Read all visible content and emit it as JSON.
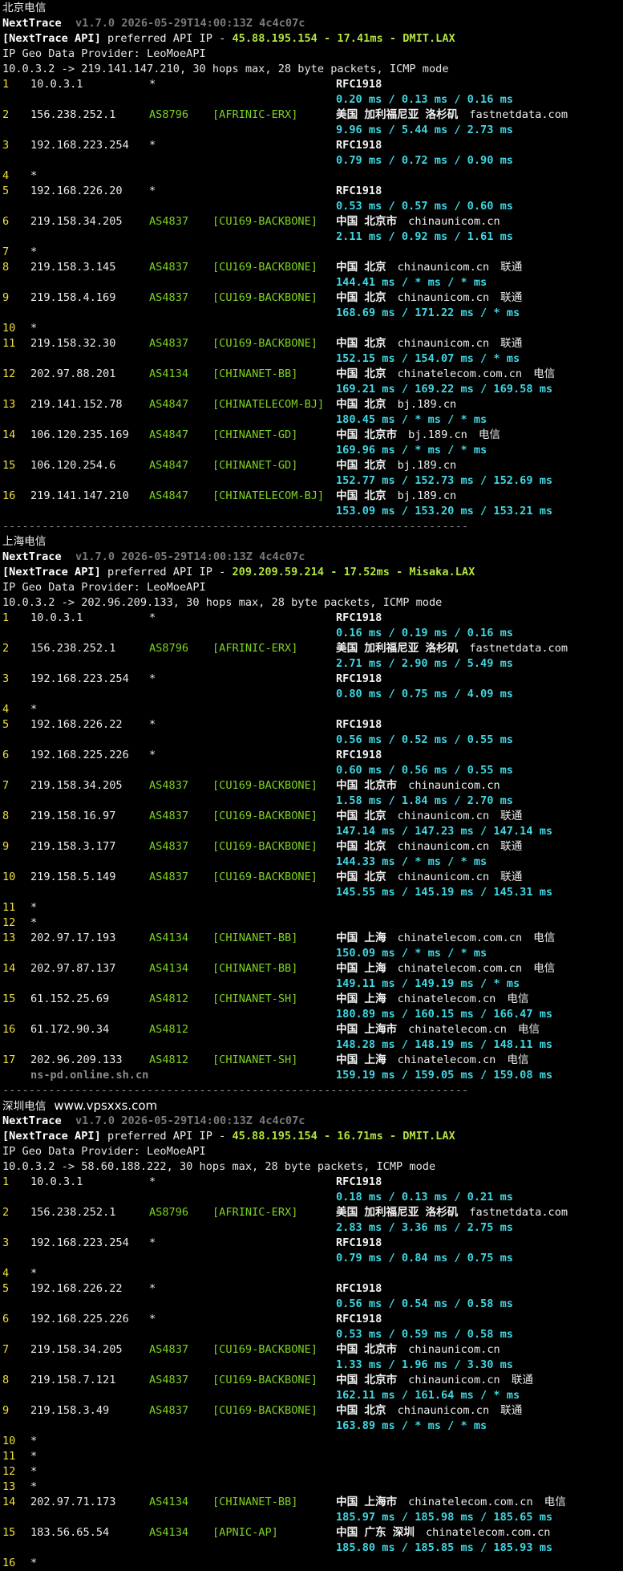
{
  "colors": {
    "background": "#000000",
    "hop": "#f1df3a",
    "asn": "#7ed321",
    "latency": "#3fd7e3",
    "highlight": "#b2e33d"
  },
  "separator": "-----------------------------------------------------------------------",
  "sections": [
    {
      "title": "北京电信",
      "site": "",
      "tool": "NextTrace",
      "version": "v1.7.0 2026-05-29T14:00:13Z 4c4c07c",
      "api_prefix": "[NextTrace API]",
      "api_text": " preferred API IP - ",
      "api_highlight": "45.88.195.154 - 17.41ms - DMIT.LAX",
      "provider": "IP Geo Data Provider: LeoMoeAPI",
      "route": "10.0.3.2 -> 219.141.147.210, 30 hops max, 28 byte packets, ICMP mode",
      "hops": [
        {
          "n": "1",
          "ip": "10.0.3.1",
          "as": "*",
          "tag": "",
          "geo": "RFC1918",
          "dom": "",
          "isp": "",
          "lat": "0.20 ms / 0.13 ms / 0.16 ms"
        },
        {
          "n": "2",
          "ip": "156.238.252.1",
          "as": "AS8796",
          "tag": "[AFRINIC-ERX]",
          "geo": "美国 加利福尼亚 洛杉矶",
          "dom": "fastnetdata.com",
          "isp": "",
          "lat": "9.96 ms / 5.44 ms / 2.73 ms"
        },
        {
          "n": "3",
          "ip": "192.168.223.254",
          "as": "*",
          "tag": "",
          "geo": "RFC1918",
          "dom": "",
          "isp": "",
          "lat": "0.79 ms / 0.72 ms / 0.90 ms"
        },
        {
          "n": "4",
          "ip": "*",
          "as": "",
          "tag": "",
          "geo": "",
          "dom": "",
          "isp": "",
          "lat": ""
        },
        {
          "n": "5",
          "ip": "192.168.226.20",
          "as": "*",
          "tag": "",
          "geo": "RFC1918",
          "dom": "",
          "isp": "",
          "lat": "0.53 ms / 0.57 ms / 0.60 ms"
        },
        {
          "n": "6",
          "ip": "219.158.34.205",
          "as": "AS4837",
          "tag": "[CU169-BACKBONE]",
          "geo": "中国 北京市",
          "dom": "chinaunicom.cn",
          "isp": "",
          "lat": "2.11 ms / 0.92 ms / 1.61 ms"
        },
        {
          "n": "7",
          "ip": "*",
          "as": "",
          "tag": "",
          "geo": "",
          "dom": "",
          "isp": "",
          "lat": ""
        },
        {
          "n": "8",
          "ip": "219.158.3.145",
          "as": "AS4837",
          "tag": "[CU169-BACKBONE]",
          "geo": "中国 北京",
          "dom": "chinaunicom.cn",
          "isp": "联通",
          "lat": "144.41 ms / * ms / * ms"
        },
        {
          "n": "9",
          "ip": "219.158.4.169",
          "as": "AS4837",
          "tag": "[CU169-BACKBONE]",
          "geo": "中国 北京",
          "dom": "chinaunicom.cn",
          "isp": "联通",
          "lat": "168.69 ms / 171.22 ms / * ms"
        },
        {
          "n": "10",
          "ip": "*",
          "as": "",
          "tag": "",
          "geo": "",
          "dom": "",
          "isp": "",
          "lat": ""
        },
        {
          "n": "11",
          "ip": "219.158.32.30",
          "as": "AS4837",
          "tag": "[CU169-BACKBONE]",
          "geo": "中国 北京",
          "dom": "chinaunicom.cn",
          "isp": "联通",
          "lat": "152.15 ms / 154.07 ms / * ms"
        },
        {
          "n": "12",
          "ip": "202.97.88.201",
          "as": "AS4134",
          "tag": "[CHINANET-BB]",
          "geo": "中国 北京",
          "dom": "chinatelecom.com.cn",
          "isp": "电信",
          "lat": "169.21 ms / 169.22 ms / 169.58 ms"
        },
        {
          "n": "13",
          "ip": "219.141.152.78",
          "as": "AS4847",
          "tag": "[CHINATELECOM-BJ]",
          "geo": "中国 北京",
          "dom": "bj.189.cn",
          "isp": "",
          "lat": "180.45 ms / * ms / * ms"
        },
        {
          "n": "14",
          "ip": "106.120.235.169",
          "as": "AS4847",
          "tag": "[CHINANET-GD]",
          "geo": "中国 北京市",
          "dom": "bj.189.cn",
          "isp": "电信",
          "lat": "169.96 ms / * ms / * ms"
        },
        {
          "n": "15",
          "ip": "106.120.254.6",
          "as": "AS4847",
          "tag": "[CHINANET-GD]",
          "geo": "中国 北京",
          "dom": "bj.189.cn",
          "isp": "",
          "lat": "152.77 ms / 152.73 ms / 152.69 ms"
        },
        {
          "n": "16",
          "ip": "219.141.147.210",
          "as": "AS4847",
          "tag": "[CHINATELECOM-BJ]",
          "geo": "中国 北京",
          "dom": "bj.189.cn",
          "isp": "",
          "lat": "153.09 ms / 153.20 ms / 153.21 ms"
        }
      ]
    },
    {
      "title": "上海电信",
      "site": "",
      "tool": "NextTrace",
      "version": "v1.7.0 2026-05-29T14:00:13Z 4c4c07c",
      "api_prefix": "[NextTrace API]",
      "api_text": " preferred API IP - ",
      "api_highlight": "209.209.59.214 - 17.52ms - Misaka.LAX",
      "provider": "IP Geo Data Provider: LeoMoeAPI",
      "route": "10.0.3.2 -> 202.96.209.133, 30 hops max, 28 byte packets, ICMP mode",
      "hops": [
        {
          "n": "1",
          "ip": "10.0.3.1",
          "as": "*",
          "tag": "",
          "geo": "RFC1918",
          "dom": "",
          "isp": "",
          "lat": "0.16 ms / 0.19 ms / 0.16 ms"
        },
        {
          "n": "2",
          "ip": "156.238.252.1",
          "as": "AS8796",
          "tag": "[AFRINIC-ERX]",
          "geo": "美国 加利福尼亚 洛杉矶",
          "dom": "fastnetdata.com",
          "isp": "",
          "lat": "2.71 ms / 2.90 ms / 5.49 ms"
        },
        {
          "n": "3",
          "ip": "192.168.223.254",
          "as": "*",
          "tag": "",
          "geo": "RFC1918",
          "dom": "",
          "isp": "",
          "lat": "0.80 ms / 0.75 ms / 4.09 ms"
        },
        {
          "n": "4",
          "ip": "*",
          "as": "",
          "tag": "",
          "geo": "",
          "dom": "",
          "isp": "",
          "lat": ""
        },
        {
          "n": "5",
          "ip": "192.168.226.22",
          "as": "*",
          "tag": "",
          "geo": "RFC1918",
          "dom": "",
          "isp": "",
          "lat": "0.56 ms / 0.52 ms / 0.55 ms"
        },
        {
          "n": "6",
          "ip": "192.168.225.226",
          "as": "*",
          "tag": "",
          "geo": "RFC1918",
          "dom": "",
          "isp": "",
          "lat": "0.60 ms / 0.56 ms / 0.55 ms"
        },
        {
          "n": "7",
          "ip": "219.158.34.205",
          "as": "AS4837",
          "tag": "[CU169-BACKBONE]",
          "geo": "中国 北京市",
          "dom": "chinaunicom.cn",
          "isp": "",
          "lat": "1.58 ms / 1.84 ms / 2.70 ms"
        },
        {
          "n": "8",
          "ip": "219.158.16.97",
          "as": "AS4837",
          "tag": "[CU169-BACKBONE]",
          "geo": "中国 北京",
          "dom": "chinaunicom.cn",
          "isp": "联通",
          "lat": "147.14 ms / 147.23 ms / 147.14 ms"
        },
        {
          "n": "9",
          "ip": "219.158.3.177",
          "as": "AS4837",
          "tag": "[CU169-BACKBONE]",
          "geo": "中国 北京",
          "dom": "chinaunicom.cn",
          "isp": "联通",
          "lat": "144.33 ms / * ms / * ms"
        },
        {
          "n": "10",
          "ip": "219.158.5.149",
          "as": "AS4837",
          "tag": "[CU169-BACKBONE]",
          "geo": "中国 北京",
          "dom": "chinaunicom.cn",
          "isp": "联通",
          "lat": "145.55 ms / 145.19 ms / 145.31 ms"
        },
        {
          "n": "11",
          "ip": "*",
          "as": "",
          "tag": "",
          "geo": "",
          "dom": "",
          "isp": "",
          "lat": ""
        },
        {
          "n": "12",
          "ip": "*",
          "as": "",
          "tag": "",
          "geo": "",
          "dom": "",
          "isp": "",
          "lat": ""
        },
        {
          "n": "13",
          "ip": "202.97.17.193",
          "as": "AS4134",
          "tag": "[CHINANET-BB]",
          "geo": "中国 上海",
          "dom": "chinatelecom.com.cn",
          "isp": "电信",
          "lat": "150.09 ms / * ms / * ms"
        },
        {
          "n": "14",
          "ip": "202.97.87.137",
          "as": "AS4134",
          "tag": "[CHINANET-BB]",
          "geo": "中国 上海",
          "dom": "chinatelecom.com.cn",
          "isp": "电信",
          "lat": "149.11 ms / 149.19 ms / * ms"
        },
        {
          "n": "15",
          "ip": "61.152.25.69",
          "as": "AS4812",
          "tag": "[CHINANET-SH]",
          "geo": "中国 上海",
          "dom": "chinatelecom.cn",
          "isp": "电信",
          "lat": "180.89 ms / 160.15 ms / 166.47 ms"
        },
        {
          "n": "16",
          "ip": "61.172.90.34",
          "as": "AS4812",
          "tag": "",
          "geo": "中国 上海市",
          "dom": "chinatelecom.cn",
          "isp": "电信",
          "lat": "148.28 ms / 148.19 ms / 148.11 ms"
        },
        {
          "n": "17",
          "ip": "202.96.209.133",
          "as": "AS4812",
          "tag": "[CHINANET-SH]",
          "geo": "中国 上海",
          "dom": "chinatelecom.cn",
          "isp": "电信",
          "ptr": "ns-pd.online.sh.cn",
          "lat": "159.19 ms / 159.05 ms / 159.08 ms"
        }
      ]
    },
    {
      "title": "深圳电信",
      "site": "www.vpsxxs.com",
      "tool": "NextTrace",
      "version": "v1.7.0 2026-05-29T14:00:13Z 4c4c07c",
      "api_prefix": "[NextTrace API]",
      "api_text": " preferred API IP - ",
      "api_highlight": "45.88.195.154 - 16.71ms - DMIT.LAX",
      "provider": "IP Geo Data Provider: LeoMoeAPI",
      "route": "10.0.3.2 -> 58.60.188.222, 30 hops max, 28 byte packets, ICMP mode",
      "hops": [
        {
          "n": "1",
          "ip": "10.0.3.1",
          "as": "*",
          "tag": "",
          "geo": "RFC1918",
          "dom": "",
          "isp": "",
          "lat": "0.18 ms / 0.13 ms / 0.21 ms"
        },
        {
          "n": "2",
          "ip": "156.238.252.1",
          "as": "AS8796",
          "tag": "[AFRINIC-ERX]",
          "geo": "美国 加利福尼亚 洛杉矶",
          "dom": "fastnetdata.com",
          "isp": "",
          "lat": "2.83 ms / 3.36 ms / 2.75 ms"
        },
        {
          "n": "3",
          "ip": "192.168.223.254",
          "as": "*",
          "tag": "",
          "geo": "RFC1918",
          "dom": "",
          "isp": "",
          "lat": "0.79 ms / 0.84 ms / 0.75 ms"
        },
        {
          "n": "4",
          "ip": "*",
          "as": "",
          "tag": "",
          "geo": "",
          "dom": "",
          "isp": "",
          "lat": ""
        },
        {
          "n": "5",
          "ip": "192.168.226.22",
          "as": "*",
          "tag": "",
          "geo": "RFC1918",
          "dom": "",
          "isp": "",
          "lat": "0.56 ms / 0.54 ms / 0.58 ms"
        },
        {
          "n": "6",
          "ip": "192.168.225.226",
          "as": "*",
          "tag": "",
          "geo": "RFC1918",
          "dom": "",
          "isp": "",
          "lat": "0.53 ms / 0.59 ms / 0.58 ms"
        },
        {
          "n": "7",
          "ip": "219.158.34.205",
          "as": "AS4837",
          "tag": "[CU169-BACKBONE]",
          "geo": "中国 北京市",
          "dom": "chinaunicom.cn",
          "isp": "",
          "lat": "1.33 ms / 1.96 ms / 3.30 ms"
        },
        {
          "n": "8",
          "ip": "219.158.7.121",
          "as": "AS4837",
          "tag": "[CU169-BACKBONE]",
          "geo": "中国 北京市",
          "dom": "chinaunicom.cn",
          "isp": "联通",
          "lat": "162.11 ms / 161.64 ms / * ms"
        },
        {
          "n": "9",
          "ip": "219.158.3.49",
          "as": "AS4837",
          "tag": "[CU169-BACKBONE]",
          "geo": "中国 北京",
          "dom": "chinaunicom.cn",
          "isp": "联通",
          "lat": "163.89 ms / * ms / * ms"
        },
        {
          "n": "10",
          "ip": "*",
          "as": "",
          "tag": "",
          "geo": "",
          "dom": "",
          "isp": "",
          "lat": ""
        },
        {
          "n": "11",
          "ip": "*",
          "as": "",
          "tag": "",
          "geo": "",
          "dom": "",
          "isp": "",
          "lat": ""
        },
        {
          "n": "12",
          "ip": "*",
          "as": "",
          "tag": "",
          "geo": "",
          "dom": "",
          "isp": "",
          "lat": ""
        },
        {
          "n": "13",
          "ip": "*",
          "as": "",
          "tag": "",
          "geo": "",
          "dom": "",
          "isp": "",
          "lat": ""
        },
        {
          "n": "14",
          "ip": "202.97.71.173",
          "as": "AS4134",
          "tag": "[CHINANET-BB]",
          "geo": "中国 上海市",
          "dom": "chinatelecom.com.cn",
          "isp": "电信",
          "lat": "185.97 ms / 185.98 ms / 185.65 ms"
        },
        {
          "n": "15",
          "ip": "183.56.65.54",
          "as": "AS4134",
          "tag": "[APNIC-AP]",
          "geo": "中国 广东 深圳",
          "dom": "chinatelecom.com.cn",
          "isp": "",
          "lat": "185.80 ms / 185.85 ms / 185.93 ms"
        },
        {
          "n": "16",
          "ip": "*",
          "as": "",
          "tag": "",
          "geo": "",
          "dom": "",
          "isp": "",
          "lat": ""
        }
      ]
    }
  ]
}
